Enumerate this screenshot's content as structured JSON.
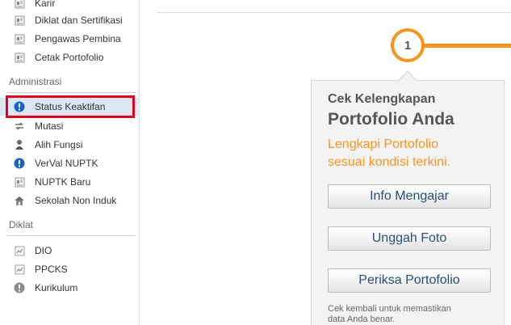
{
  "sidebar": {
    "top_items": [
      {
        "label": "Karir",
        "icon": "document-icon"
      },
      {
        "label": "Diklat dan Sertifikasi",
        "icon": "document-icon"
      },
      {
        "label": "Pengawas Pembina",
        "icon": "document-icon"
      },
      {
        "label": "Cetak Portofolio",
        "icon": "document-icon"
      }
    ],
    "section_admin": "Administrasi",
    "admin_items": [
      {
        "label": "Status Keaktifan",
        "icon": "info-circle-icon",
        "active": true
      },
      {
        "label": "Mutasi",
        "icon": "transfer-icon"
      },
      {
        "label": "Alih Fungsi",
        "icon": "person-icon"
      },
      {
        "label": "VerVal NUPTK",
        "icon": "info-circle-icon"
      },
      {
        "label": "NUPTK Baru",
        "icon": "document-icon"
      },
      {
        "label": "Sekolah Non Induk",
        "icon": "school-icon"
      }
    ],
    "section_diklat": "Diklat",
    "diklat_items": [
      {
        "label": "DIO",
        "icon": "chart-doc-icon"
      },
      {
        "label": "PPCKS",
        "icon": "chart-doc-icon"
      },
      {
        "label": "Kurikulum",
        "icon": "info-circle-gray-icon"
      }
    ]
  },
  "main": {
    "step_number": "1",
    "panel": {
      "title_line1": "Cek Kelengkapan",
      "title_line2": "Portofolio Anda",
      "subtitle_line1": "Lengkapi Portofolio",
      "subtitle_line2": "sesuai kondisi terkini.",
      "buttons": [
        "Info Mengajar",
        "Unggah Foto",
        "Periksa Portofolio"
      ],
      "note_line1": "Cek kembali untuk memastikan",
      "note_line2": "data Anda benar."
    }
  },
  "colors": {
    "accent_orange": "#f7941d",
    "highlight_red": "#e0001b",
    "active_bg": "#dbe7f4",
    "info_blue": "#1565c0"
  }
}
